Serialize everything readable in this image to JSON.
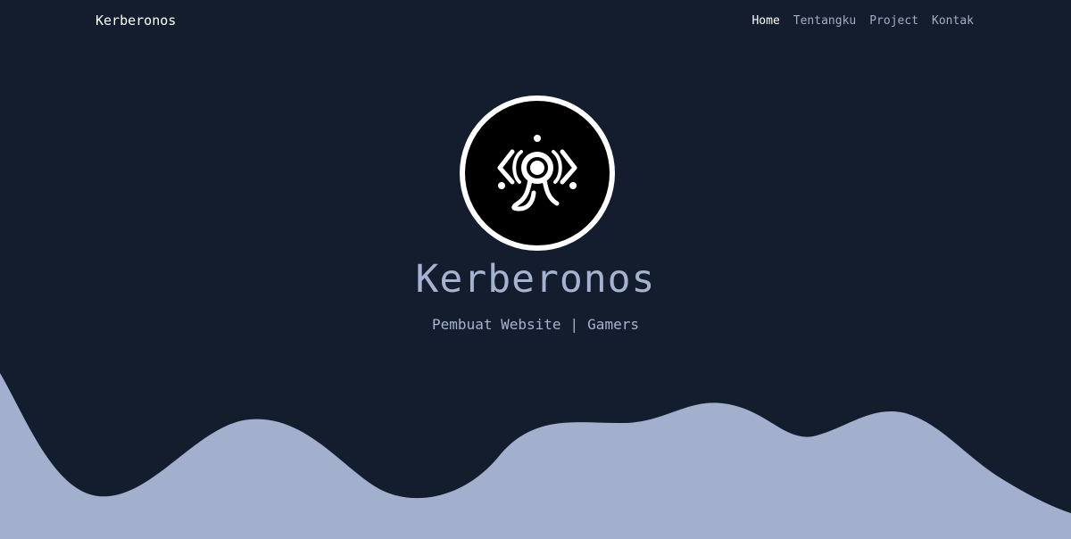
{
  "navbar": {
    "brand": "Kerberonos",
    "links": [
      {
        "label": "Home",
        "active": true
      },
      {
        "label": "Tentangku",
        "active": false
      },
      {
        "label": "Project",
        "active": false
      },
      {
        "label": "Kontak",
        "active": false
      }
    ]
  },
  "hero": {
    "logo_icon": "kerberonos-emblem-icon",
    "title": "Kerberonos",
    "subtitle_left": "Pembuat Website",
    "subtitle_separator": "|",
    "subtitle_right": "Gamers"
  },
  "colors": {
    "background": "#141d2d",
    "accent": "#a5b3d0",
    "wave": "#a2b0cd",
    "nav_active": "#ffffff",
    "nav_inactive": "#a1aec9"
  }
}
